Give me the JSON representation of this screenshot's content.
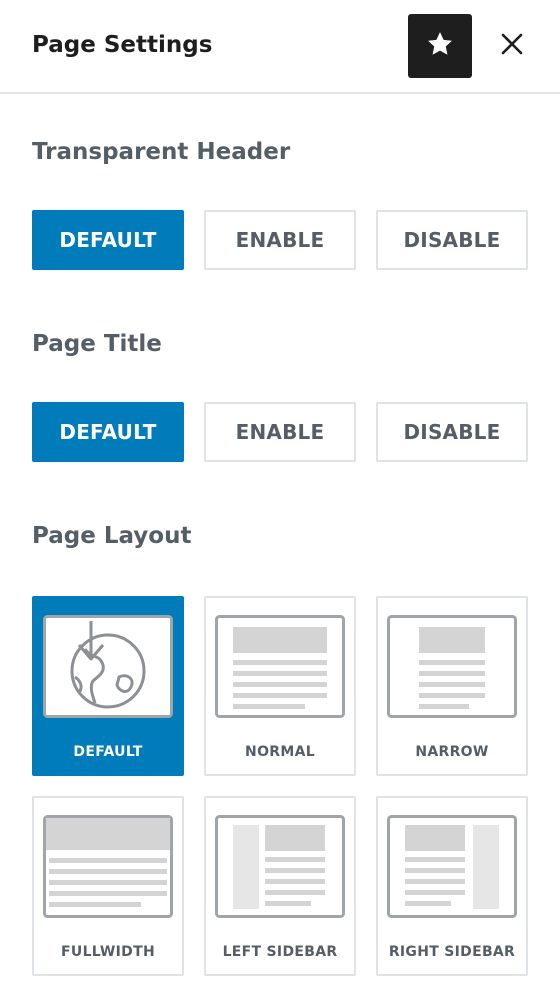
{
  "header": {
    "title": "Page Settings",
    "favorite_icon": "star-icon",
    "close_icon": "close-icon"
  },
  "transparent_header": {
    "title": "Transparent Header",
    "options": [
      "DEFAULT",
      "ENABLE",
      "DISABLE"
    ],
    "selected": "DEFAULT"
  },
  "page_title": {
    "title": "Page Title",
    "options": [
      "DEFAULT",
      "ENABLE",
      "DISABLE"
    ],
    "selected": "DEFAULT"
  },
  "page_layout": {
    "title": "Page Layout",
    "options": [
      {
        "label": "DEFAULT",
        "icon": "globe-download-icon"
      },
      {
        "label": "NORMAL",
        "icon": "layout-normal-icon"
      },
      {
        "label": "NARROW",
        "icon": "layout-narrow-icon"
      },
      {
        "label": "FULLWIDTH",
        "icon": "layout-fullwidth-icon"
      },
      {
        "label": "LEFT SIDEBAR",
        "icon": "layout-left-sidebar-icon"
      },
      {
        "label": "RIGHT SIDEBAR",
        "icon": "layout-right-sidebar-icon"
      }
    ],
    "selected": "DEFAULT"
  },
  "colors": {
    "accent": "#007cba",
    "header_button": "#1e1e1e",
    "border": "#dfe3e8",
    "muted_text": "#555d66"
  }
}
